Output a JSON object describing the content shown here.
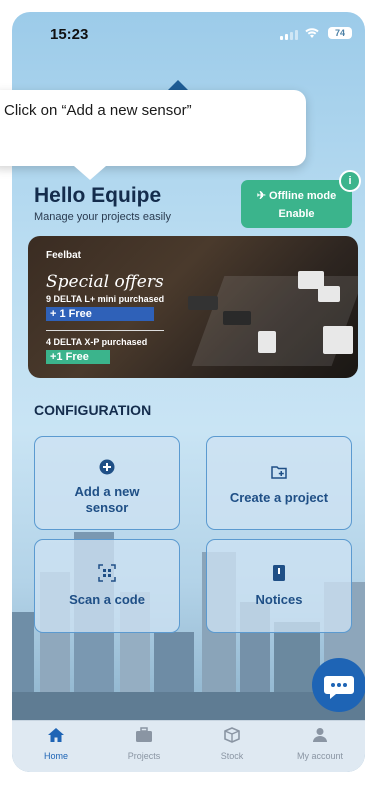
{
  "status_bar": {
    "time": "15:23",
    "battery": "74"
  },
  "tooltip": {
    "text": "Click on “Add a new sensor”"
  },
  "header": {
    "greeting": "Hello Equipe",
    "subtitle": "Manage your projects easily"
  },
  "offline_mode": {
    "title": "Offline mode",
    "action": "Enable"
  },
  "banner": {
    "brand": "Feelbat",
    "headline": "Special offers",
    "offer1": "9 DELTA L+ mini purchased",
    "offer1_free": "+ 1 Free",
    "offer2": "4 DELTA X-P purchased",
    "offer2_free": "+1 Free"
  },
  "configuration": {
    "title": "CONFIGURATION",
    "cards": [
      {
        "label": "Add a new sensor",
        "icon": "plus-circle-icon"
      },
      {
        "label": "Create a project",
        "icon": "folder-plus-icon"
      },
      {
        "label": "Scan a code",
        "icon": "qr-scan-icon"
      },
      {
        "label": "Notices",
        "icon": "book-icon"
      }
    ]
  },
  "tabs": [
    {
      "label": "Home",
      "icon": "home-icon"
    },
    {
      "label": "Projects",
      "icon": "briefcase-icon"
    },
    {
      "label": "Stock",
      "icon": "box-icon"
    },
    {
      "label": "My account",
      "icon": "user-icon"
    }
  ],
  "colors": {
    "accent": "#1e64b5",
    "offline": "#3bb48c",
    "heading": "#142c4c"
  }
}
